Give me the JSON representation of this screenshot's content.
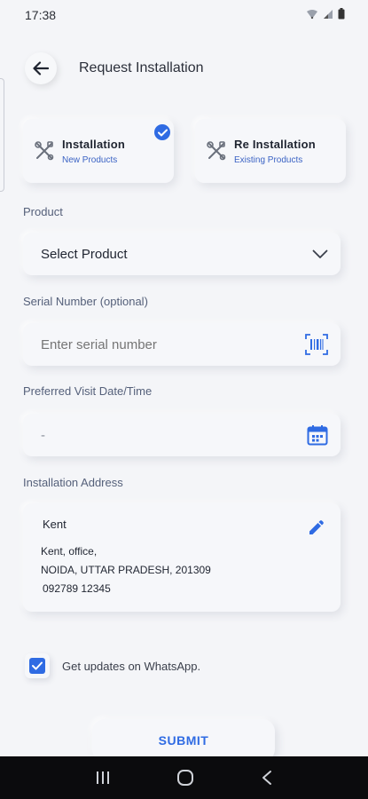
{
  "status": {
    "time": "17:38"
  },
  "header": {
    "title": "Request Installation"
  },
  "types": [
    {
      "title": "Installation",
      "subtitle": "New Products",
      "selected": true
    },
    {
      "title": "Re Installation",
      "subtitle": "Existing Products",
      "selected": false
    }
  ],
  "product": {
    "label": "Product",
    "value": "Select Product"
  },
  "serial": {
    "label": "Serial Number (optional)",
    "placeholder": "Enter serial number"
  },
  "visit": {
    "label": "Preferred Visit Date/Time",
    "value": "-"
  },
  "address": {
    "label": "Installation Address",
    "name": "Kent",
    "line1": "Kent, office,",
    "line2": "NOIDA, UTTAR PRADESH, 201309",
    "phone": "092789 12345"
  },
  "whatsapp": {
    "label": "Get updates on WhatsApp.",
    "checked": true
  },
  "submit": {
    "label": "SUBMIT"
  },
  "colors": {
    "accent": "#2f6be3",
    "background": "#f4f5f8",
    "navbar": "#0b0b0d"
  }
}
